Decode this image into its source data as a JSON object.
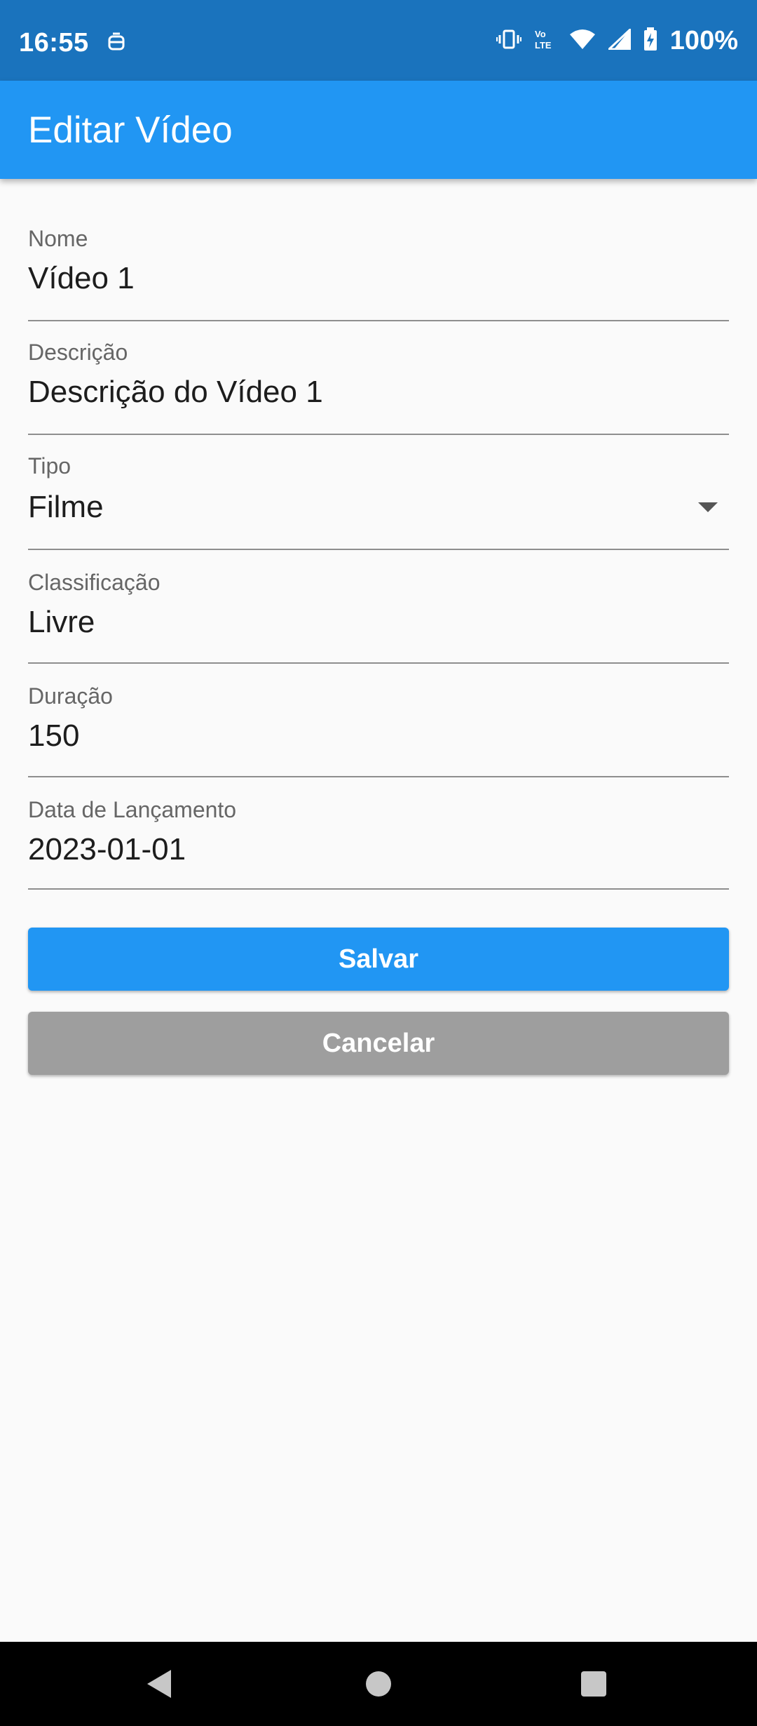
{
  "status": {
    "time": "16:55",
    "battery": "100%",
    "icons": [
      "notification-icon",
      "vibrate-icon",
      "volte-icon",
      "wifi-icon",
      "signal-icon",
      "battery-charging-icon"
    ]
  },
  "appbar": {
    "title": "Editar Vídeo"
  },
  "form": {
    "nome": {
      "label": "Nome",
      "value": "Vídeo 1"
    },
    "descricao": {
      "label": "Descrição",
      "value": "Descrição do Vídeo 1"
    },
    "tipo": {
      "label": "Tipo",
      "value": "Filme"
    },
    "classificacao": {
      "label": "Classificação",
      "value": "Livre"
    },
    "duracao": {
      "label": "Duração",
      "value": "150"
    },
    "data_lancamento": {
      "label": "Data de Lançamento",
      "value": "2023-01-01"
    }
  },
  "buttons": {
    "save": "Salvar",
    "cancel": "Cancelar"
  },
  "colors": {
    "primary": "#2196f3",
    "status_bar": "#1a73bd",
    "cancel": "#9e9e9e"
  }
}
